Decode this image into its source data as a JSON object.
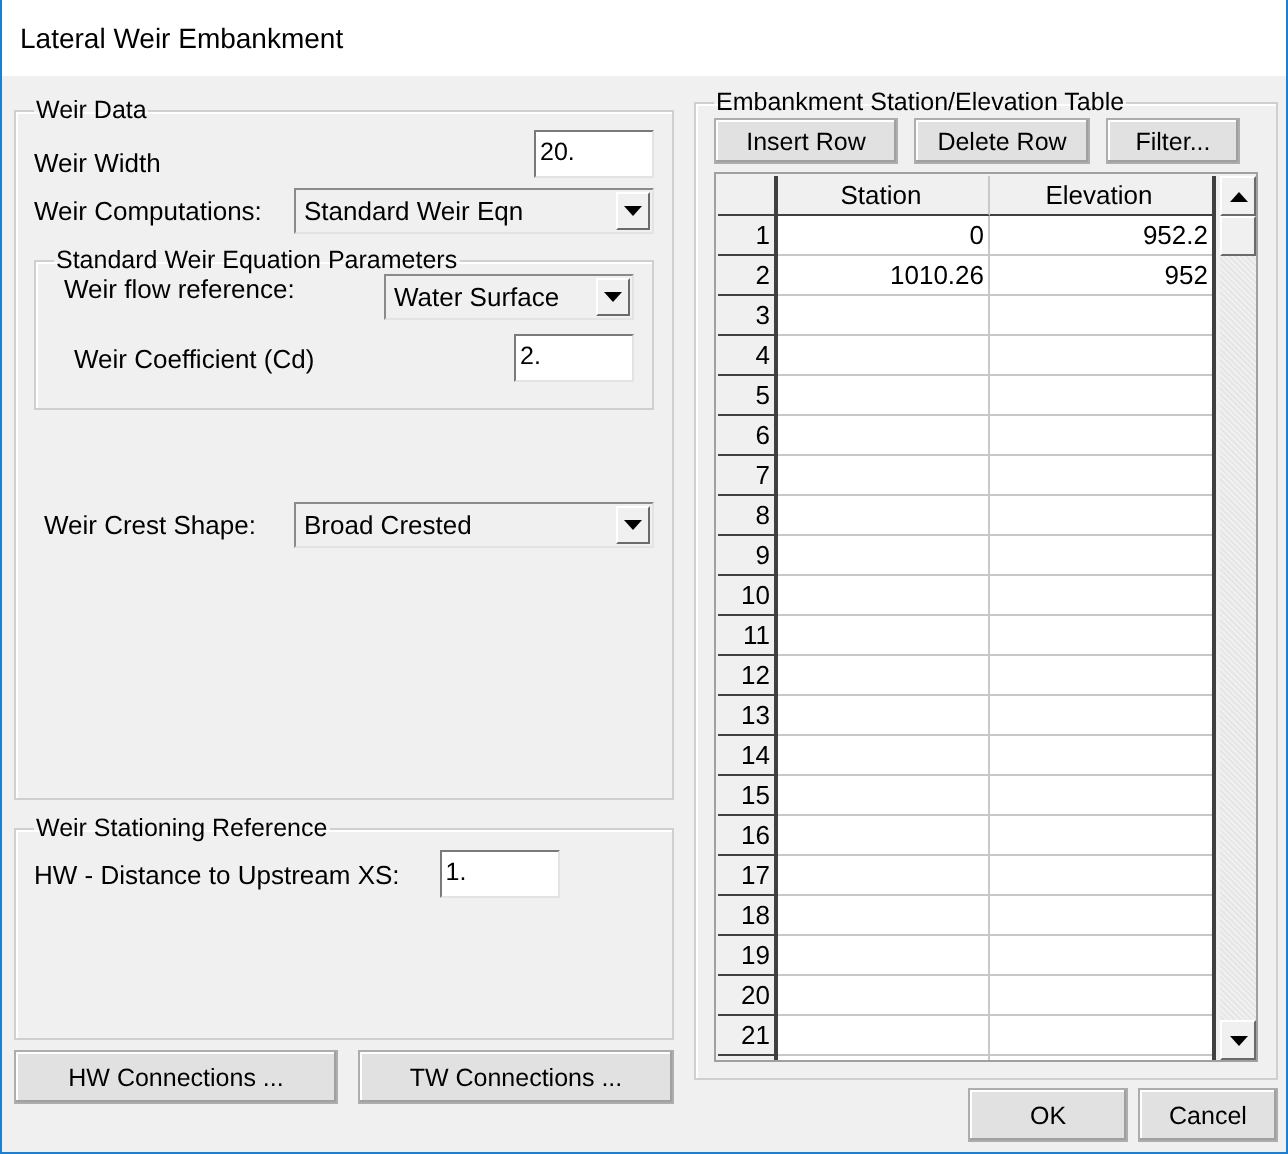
{
  "window": {
    "title": "Lateral Weir Embankment"
  },
  "weir_data": {
    "title": "Weir Data",
    "weir_width": {
      "label": "Weir Width",
      "value": "20."
    },
    "weir_computations": {
      "label": "Weir Computations:",
      "value": "Standard Weir Eqn"
    },
    "parameters": {
      "title": "Standard Weir Equation Parameters",
      "flow_reference": {
        "label": "Weir flow reference:",
        "value": "Water Surface"
      },
      "coefficient": {
        "label": "Weir Coefficient (Cd)",
        "value": "2."
      }
    },
    "crest_shape": {
      "label": "Weir Crest Shape:",
      "value": "Broad Crested"
    }
  },
  "stationing": {
    "title": "Weir Stationing Reference",
    "hw_distance": {
      "label": "HW - Distance to Upstream XS:",
      "value": "1."
    }
  },
  "connection_buttons": [
    "HW Connections ...",
    "TW Connections ..."
  ],
  "table": {
    "title": "Embankment Station/Elevation Table",
    "buttons": [
      "Insert Row",
      "Delete Row",
      "Filter..."
    ],
    "columns": [
      "Station",
      "Elevation"
    ],
    "rows": [
      {
        "number": "1",
        "station": "0",
        "elevation": "952.2"
      },
      {
        "number": "2",
        "station": "1010.26",
        "elevation": "952"
      },
      {
        "number": "3"
      },
      {
        "number": "4"
      },
      {
        "number": "5"
      },
      {
        "number": "6"
      },
      {
        "number": "7"
      },
      {
        "number": "8"
      },
      {
        "number": "9"
      },
      {
        "number": "10"
      },
      {
        "number": "11"
      },
      {
        "number": "12"
      },
      {
        "number": "13"
      },
      {
        "number": "14"
      },
      {
        "number": "15"
      },
      {
        "number": "16"
      },
      {
        "number": "17"
      },
      {
        "number": "18"
      },
      {
        "number": "19"
      },
      {
        "number": "20"
      },
      {
        "number": "21"
      }
    ]
  },
  "buttons": [
    "OK",
    "Cancel"
  ]
}
